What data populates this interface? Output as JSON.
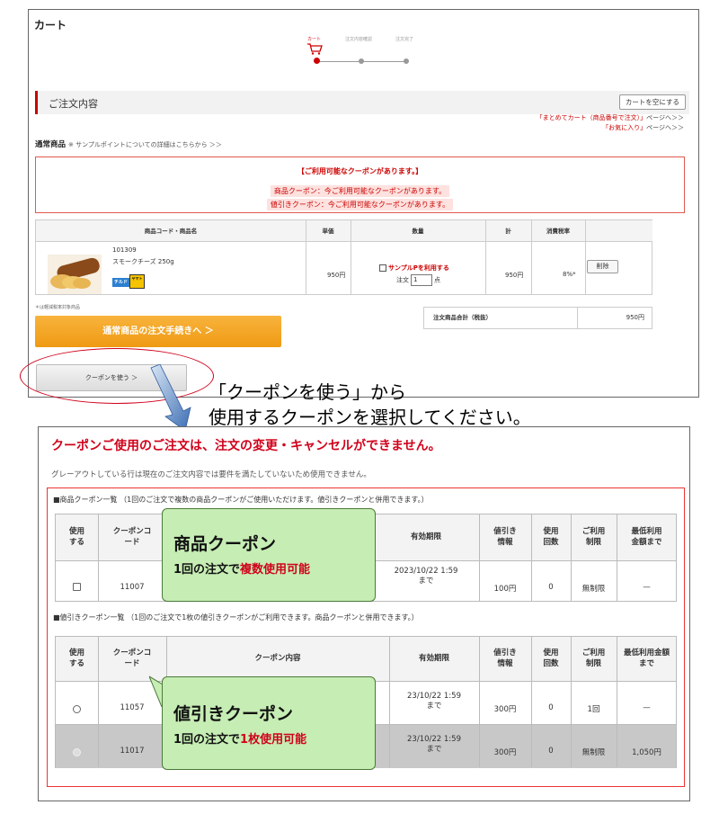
{
  "cart": {
    "title": "カート",
    "steps": [
      "カート",
      "注文内容確認",
      "注文完了"
    ],
    "order_heading": "ご注文内容",
    "empty_cart_button": "カートを空にする",
    "link_bulk_quoted": "「まとめてカート（商品番号で注文）」",
    "link_bulk_suffix": "ページへ＞＞",
    "link_fav_quoted": "「お気に入り」",
    "link_fav_suffix": "ページへ＞＞",
    "normal_items_title": "通常商品",
    "sample_point_note": "※ サンプルポイントについての詳細はこちらから ＞＞",
    "coupon_notice": {
      "heading": "【ご利用可能なクーポンがあります。】",
      "product_line": "商品クーポン：今ご利用可能なクーポンがあります。",
      "discount_line": "値引きクーポン：今ご利用可能なクーポンがあります。"
    },
    "table_headers": [
      "商品コード・商品名",
      "単価",
      "数量",
      "計",
      "消費税率",
      ""
    ],
    "item": {
      "code": "101309",
      "name": "スモークチーズ 250g",
      "badge_chilled": "チルド",
      "badge_yamato": "ヤマト",
      "price": "950円",
      "sample_p_label": "サンプルPを利用する",
      "qty_prefix": "注文",
      "qty_value": "1",
      "qty_unit": "点",
      "subtotal": "950円",
      "tax_rate": "8%*",
      "delete_button": "削除"
    },
    "tax_note": "＊は軽減税率対象商品",
    "checkout_button": "通常商品の注文手続きへ ＞",
    "total_label": "注文商品合計（税抜）",
    "total_value": "950円",
    "use_coupon_button": "クーポンを使う ＞"
  },
  "caption": {
    "line1": "「クーポンを使う」から",
    "line2": "使用するクーポンを選択してください。"
  },
  "coupon_page": {
    "warning": "クーポンご使用のご注文は、注文の変更・キャンセルができません。",
    "gray_note": "グレーアウトしている行は現在のご注文内容では要件を満たしていないため使用できません。",
    "product_section_title": "■商品クーポン一覧 （1回のご注文で複数の商品クーポンがご使用いただけます。値引きクーポンと併用できます。）",
    "discount_section_title": "■値引きクーポン一覧 （1回のご注文で1枚の値引きクーポンがご利用できます。商品クーポンと併用できます。）",
    "headers": {
      "use": "使用\nする",
      "code": "クーポンコ\nード",
      "content": "クーポン内容",
      "expiry": "有効期限",
      "discount": "値引き\n情報",
      "count": "使用\n回数",
      "limit": "ご利用\n制限",
      "min_amount_product": "最低利用\n金額まで",
      "min_amount_discount": "最低利用金額\nまで"
    },
    "product_rows": [
      {
        "code": "11007",
        "expiry": "2023/10/22 1:59\nまで",
        "discount": "100円",
        "count": "0",
        "limit": "無制限",
        "min": "—"
      }
    ],
    "discount_rows": [
      {
        "code": "11057",
        "expiry": "23/10/22 1:59\nまで",
        "discount": "300円",
        "count": "0",
        "limit": "1回",
        "min": "—",
        "disabled": false
      },
      {
        "code": "11017",
        "expiry": "23/10/22 1:59\nまで",
        "discount": "300円",
        "count": "0",
        "limit": "無制限",
        "min": "1,050円",
        "disabled": true
      }
    ],
    "callout_product": {
      "title": "商品クーポン",
      "sub_prefix": "1回の注文で",
      "sub_highlight": "複数使用可能"
    },
    "callout_discount": {
      "title": "値引きクーポン",
      "sub_prefix": "1回の注文で",
      "sub_highlight": "1枚使用可能"
    }
  },
  "colors": {
    "accent_red": "#d0021b",
    "checkout_orange": "#f0a020",
    "callout_green": "#c6edb4",
    "gray_row": "#c8c8c8"
  }
}
